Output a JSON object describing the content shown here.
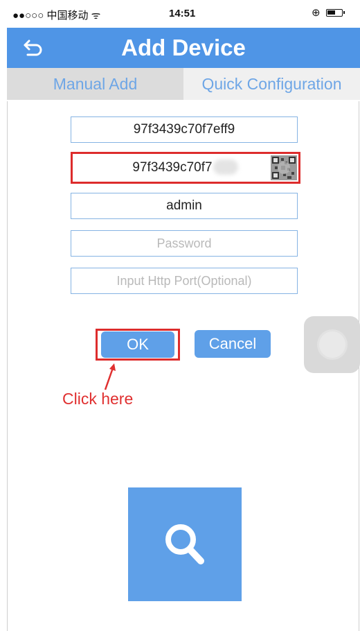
{
  "status_bar": {
    "carrier": "●●○○○ 中国移动 ᯤ",
    "time": "14:51",
    "lock_glyph": "⊕"
  },
  "nav": {
    "title": "Add Device",
    "back_icon": "back-arrow-icon"
  },
  "tabs": [
    {
      "label": "Manual Add"
    },
    {
      "label": "Quick Configuration"
    }
  ],
  "form": {
    "device_id": "97f3439c70f7eff9",
    "device_id_confirm": "97f3439c70f7",
    "username": "admin",
    "password_placeholder": "Password",
    "port_placeholder": "Input Http Port(Optional)"
  },
  "buttons": {
    "ok": "OK",
    "cancel": "Cancel"
  },
  "annotation": {
    "text": "Click here",
    "color": "#e03030"
  },
  "colors": {
    "accent": "#4f95e6",
    "button": "#5fa0e8",
    "highlight": "#dd2c2c"
  }
}
